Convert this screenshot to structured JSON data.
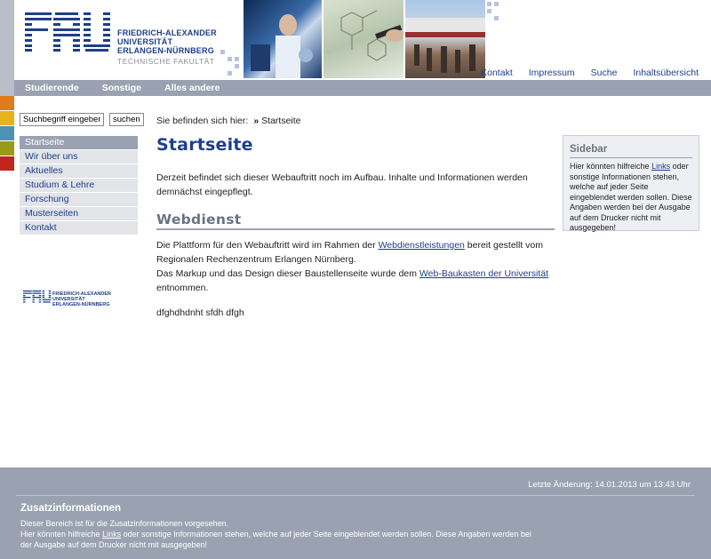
{
  "colors": {
    "brand_blue": "#1d3f8a",
    "nav_grey": "#9aa2b1",
    "strip": [
      "#e07b1b",
      "#e8b21a",
      "#4f91b4",
      "#9a9a1a",
      "#c1251c"
    ]
  },
  "header": {
    "logo_text": "FAU",
    "logo_name_lines": [
      "FRIEDRICH-ALEXANDER",
      "UNIVERSITÄT",
      "ERLANGEN-NÜRNBERG"
    ],
    "faculty": "TECHNISCHE FAKULTÄT",
    "top_links": [
      "Kontakt",
      "Impressum",
      "Suche",
      "Inhaltsübersicht"
    ]
  },
  "mainnav": {
    "items": [
      "Studierende",
      "Sonstige",
      "Alles andere"
    ]
  },
  "search": {
    "value": "Suchbegriff eingeben",
    "button": "suchen"
  },
  "subnav": {
    "items": [
      "Startseite",
      "Wir über uns",
      "Aktuelles",
      "Studium & Lehre",
      "Forschung",
      "Musterseiten",
      "Kontakt"
    ]
  },
  "breadcrumb": {
    "label": "Sie befinden sich hier:",
    "separator": "»",
    "current": "Startseite"
  },
  "content": {
    "title": "Startseite",
    "intro": "Derzeit befindet sich dieser Webauftritt noch im Aufbau. Inhalte und Informationen werden demnächst eingepflegt.",
    "section_title": "Webdienst",
    "p1_before": "Die Plattform für den Webauftritt wird im Rahmen der ",
    "p1_link": "Webdienstleistungen",
    "p1_after": " bereit gestellt vom Regionalen Rechenzentrum Erlangen Nürnberg.",
    "p2_before": "Das Markup und das Design dieser Baustellenseite wurde dem ",
    "p2_link": "Web-Baukasten der Universität",
    "p2_after": " entnommen.",
    "p3": "dfghdhdnht sfdh dfgh"
  },
  "sidebar": {
    "title": "Sidebar",
    "text_before": "Hier könnten hilfreiche ",
    "link": "Links",
    "text_after": " oder sonstige Informationen stehen, welche auf jeder Seite eingeblendet werden sollen. Diese Angaben werden bei der Ausgabe auf dem Drucker nicht mit ausgegeben!"
  },
  "footer": {
    "modified": "Letzte Änderung: 14.01.2013 um 13:43 Uhr",
    "title": "Zusatzinformationen",
    "line1": "Dieser Bereich ist für die Zusatzinformationen vorgesehen.",
    "line2_before": "Hier könnten hilfreiche ",
    "line2_link": "Links",
    "line2_after": " oder sonstige Informationen stehen, welche auf jeder Seite eingeblendet werden sollen. Diese Angaben werden bei der Ausgabe auf dem Drucker nicht mit ausgegeben!"
  }
}
